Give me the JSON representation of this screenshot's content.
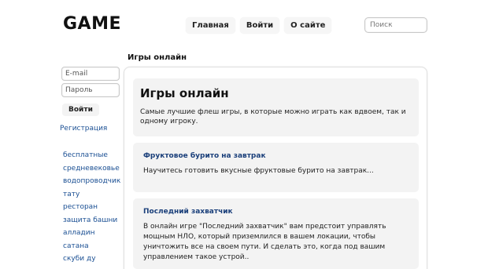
{
  "header": {
    "logo": "GAME",
    "nav": [
      "Главная",
      "Войти",
      "О сайте"
    ],
    "search_placeholder": "Поиск"
  },
  "sidebar": {
    "email_placeholder": "E-mail",
    "password_placeholder": "Пароль",
    "login_label": "Войти",
    "register_label": "Регистрация",
    "categories": [
      "бесплатные",
      "средневековье",
      "водопроводчик",
      "тату",
      "ресторан",
      "защита башни",
      "алладин",
      "сатана",
      "скуби ду"
    ]
  },
  "main": {
    "page_title": "Игры онлайн",
    "hero": {
      "title": "Игры онлайн",
      "text": "Самые лучшие флеш игры, в которые можно играть как вдвоем, так и одному игроку."
    },
    "cards": [
      {
        "title": "Фруктовое бурито на завтрак",
        "text": "Научитесь готовить вкусные фруктовые бурито на завтрак..."
      },
      {
        "title": "Последний захватчик",
        "text": "В онлайн игре \"Последний захватчик\" вам предстоит управлять мощным НЛО, который приземлился в вашем локации, чтобы уничтожить все на своем пути. И сделать это, когда под вашим управлением такое устрой.."
      }
    ]
  }
}
